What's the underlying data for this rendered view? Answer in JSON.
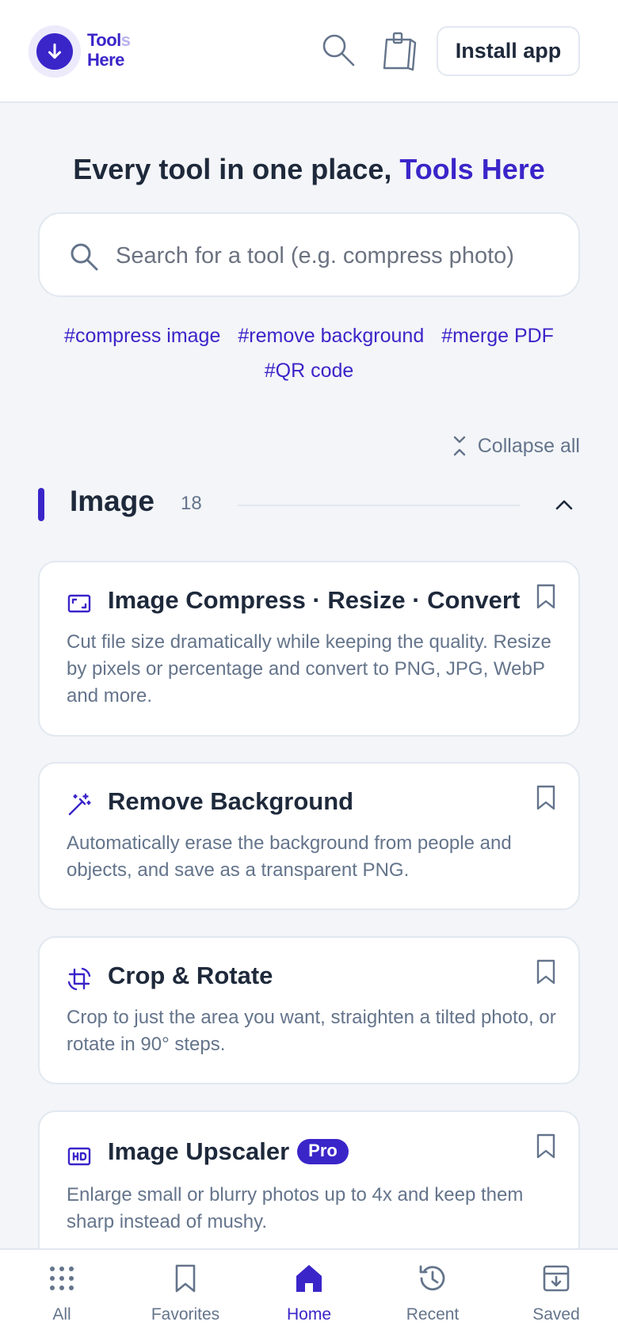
{
  "header": {
    "logo_line1": "Tool",
    "logo_line1_faint": "s",
    "logo_line2": "Here",
    "install_label": "Install app"
  },
  "hero": {
    "title_prefix": "Every tool in one place, ",
    "title_brand": "Tools Here"
  },
  "search": {
    "placeholder": "Search for a tool (e.g. compress photo)",
    "value": ""
  },
  "tags": [
    "#compress image",
    "#remove background",
    "#merge PDF",
    "#QR code"
  ],
  "collapse_all_label": "Collapse all",
  "section": {
    "title": "Image",
    "count": "18"
  },
  "cards": [
    {
      "icon": "image-frame-icon",
      "title": "Image Compress · Resize · Convert",
      "description": "Cut file size dramatically while keeping the quality. Resize by pixels or percentage and convert to PNG, JPG, WebP and more."
    },
    {
      "icon": "magic-wand-icon",
      "title": "Remove Background",
      "description": "Automatically erase the background from people and objects, and save as a transparent PNG."
    },
    {
      "icon": "crop-rotate-icon",
      "title": "Crop & Rotate",
      "description": "Crop to just the area you want, straighten a tilted photo, or rotate in 90° steps."
    },
    {
      "icon": "hd-icon",
      "title": "Image Upscaler",
      "badge": "Pro",
      "description": "Enlarge small or blurry photos up to 4x and keep them sharp instead of mushy."
    }
  ],
  "nav": [
    {
      "label": "All",
      "icon": "grid-dots-icon",
      "active": false
    },
    {
      "label": "Favorites",
      "icon": "bookmark-icon",
      "active": false
    },
    {
      "label": "Home",
      "icon": "home-icon",
      "active": true
    },
    {
      "label": "Recent",
      "icon": "history-icon",
      "active": false
    },
    {
      "label": "Saved",
      "icon": "archive-download-icon",
      "active": false
    }
  ],
  "colors": {
    "accent": "#3a25c9",
    "text": "#1e293b",
    "muted": "#64748b",
    "background": "#f3f5f8",
    "border": "#e2e8f0"
  }
}
